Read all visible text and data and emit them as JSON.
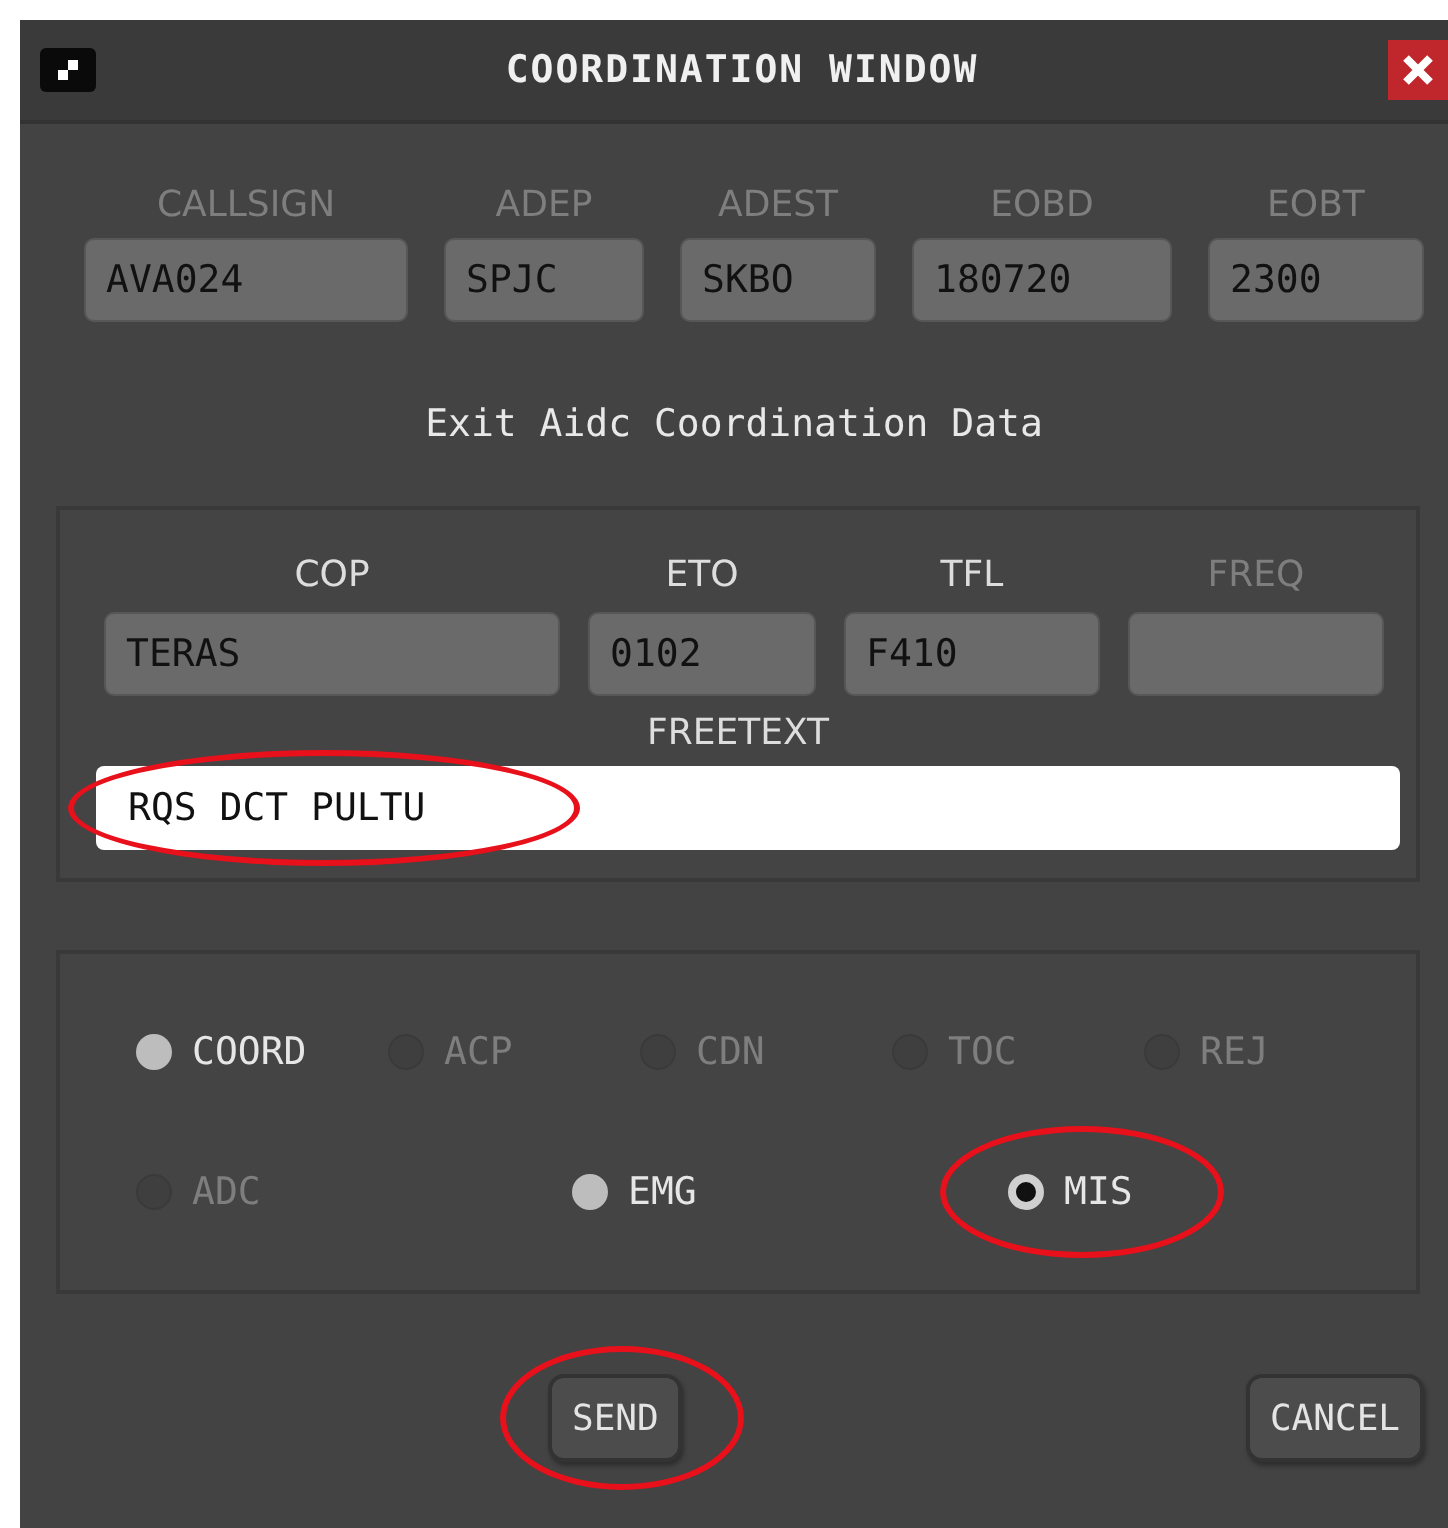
{
  "window": {
    "title": "COORDINATION WINDOW"
  },
  "flight_fields": [
    {
      "label": "CALLSIGN",
      "value": "AVA024",
      "disabled": true
    },
    {
      "label": "ADEP",
      "value": "SPJC",
      "disabled": true
    },
    {
      "label": "ADEST",
      "value": "SKBO",
      "disabled": true
    },
    {
      "label": "EOBD",
      "value": "180720",
      "disabled": true
    },
    {
      "label": "EOBT",
      "value": "2300",
      "disabled": true
    }
  ],
  "section_title": "Exit Aidc Coordination Data",
  "coordination_fields": [
    {
      "label": "COP",
      "value": "TERAS",
      "disabled": false
    },
    {
      "label": "ETO",
      "value": "0102",
      "disabled": false
    },
    {
      "label": "TFL",
      "value": "F410",
      "disabled": false
    },
    {
      "label": "FREQ",
      "disabled": true
    }
  ],
  "freetext": {
    "label": "FREETEXT",
    "value": "RQS DCT PULTU",
    "highlighted": true
  },
  "radio_rows": [
    [
      {
        "label": "COORD",
        "disabled": false,
        "selected": false,
        "highlighted": false
      },
      {
        "label": "ACP",
        "disabled": true,
        "selected": false,
        "highlighted": false
      },
      {
        "label": "CDN",
        "disabled": true,
        "selected": false,
        "highlighted": false
      },
      {
        "label": "TOC",
        "disabled": true,
        "selected": false,
        "highlighted": false
      },
      {
        "label": "REJ",
        "disabled": true,
        "selected": false,
        "highlighted": false
      }
    ],
    [
      {
        "label": "ADC",
        "disabled": true,
        "selected": false,
        "highlighted": false
      },
      {
        "label": "EMG",
        "disabled": false,
        "selected": false,
        "highlighted": false
      },
      {
        "label": "MIS",
        "disabled": false,
        "selected": true,
        "highlighted": true
      }
    ]
  ],
  "buttons": [
    {
      "label": "SEND",
      "highlighted": true
    },
    {
      "label": "CANCEL",
      "highlighted": false
    }
  ]
}
